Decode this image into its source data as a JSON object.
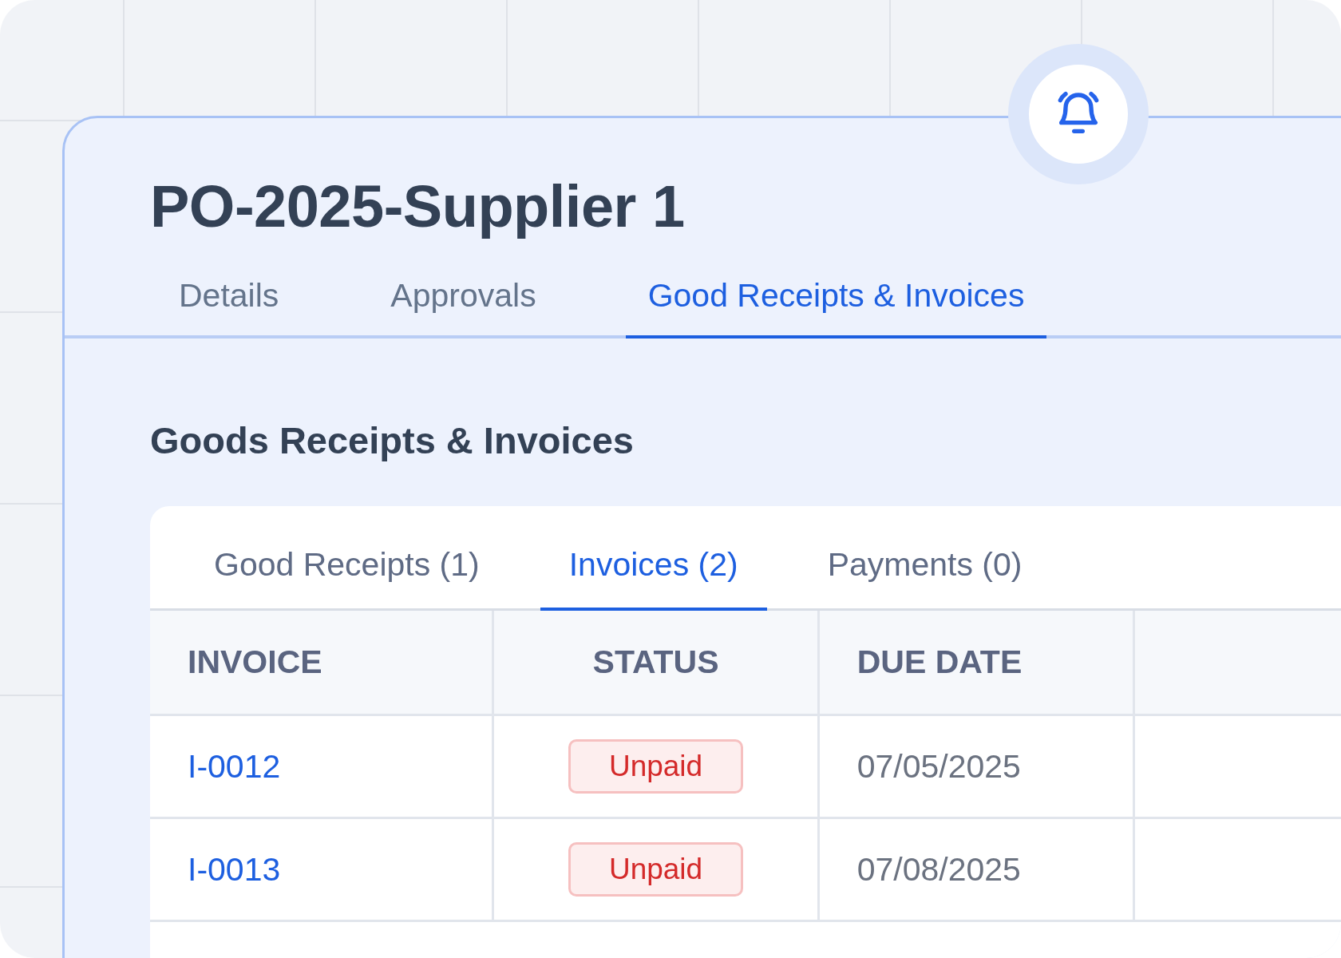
{
  "title": "PO-2025-Supplier 1",
  "tabs": [
    {
      "label": "Details",
      "selected": false
    },
    {
      "label": "Approvals",
      "selected": false
    },
    {
      "label": "Good Receipts & Invoices",
      "selected": true
    }
  ],
  "section_title": "Goods Receipts & Invoices",
  "subtabs": [
    {
      "label": "Good Receipts (1)",
      "selected": false
    },
    {
      "label": "Invoices (2)",
      "selected": true
    },
    {
      "label": "Payments (0)",
      "selected": false
    }
  ],
  "table": {
    "columns": [
      "INVOICE",
      "STATUS",
      "DUE DATE"
    ],
    "rows": [
      {
        "invoice": "I-0012",
        "status": "Unpaid",
        "due_date": "07/05/2025"
      },
      {
        "invoice": "I-0013",
        "status": "Unpaid",
        "due_date": "07/08/2025"
      }
    ]
  }
}
